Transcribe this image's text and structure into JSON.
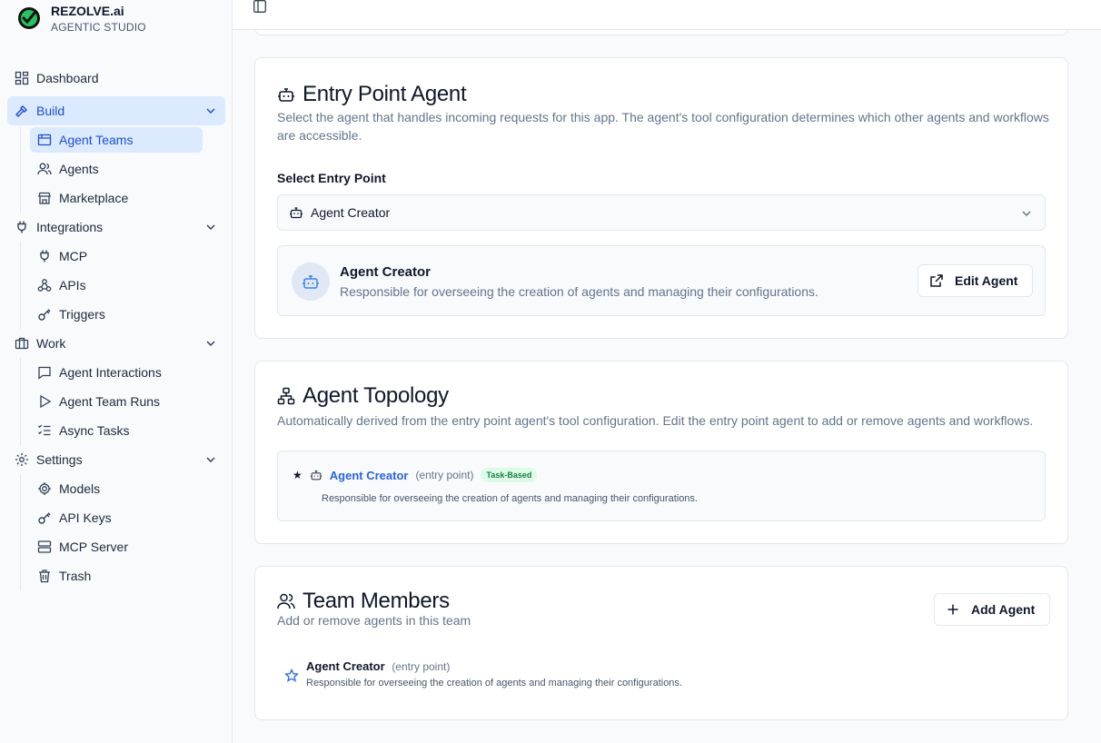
{
  "brand": {
    "name": "REZOLVE.ai",
    "subtitle": "AGENTIC STUDIO"
  },
  "nav": {
    "dashboard": "Dashboard",
    "build": "Build",
    "build_items": [
      "Agent Teams",
      "Agents",
      "Marketplace"
    ],
    "integrations": "Integrations",
    "integrations_items": [
      "MCP",
      "APIs",
      "Triggers"
    ],
    "work": "Work",
    "work_items": [
      "Agent Interactions",
      "Agent Team Runs",
      "Async Tasks"
    ],
    "settings": "Settings",
    "settings_items": [
      "Models",
      "API Keys",
      "MCP Server",
      "Trash"
    ]
  },
  "entry": {
    "title": "Entry Point Agent",
    "description": "Select the agent that handles incoming requests for this app. The agent's tool configuration determines which other agents and workflows are accessible.",
    "select_label": "Select Entry Point",
    "selected": "Agent Creator",
    "agent_name": "Agent Creator",
    "agent_desc": "Responsible for overseeing the creation of agents and managing their configurations.",
    "edit_button": "Edit Agent"
  },
  "topology": {
    "title": "Agent Topology",
    "description": "Automatically derived from the entry point agent's tool configuration. Edit the entry point agent to add or remove agents and workflows.",
    "star": "★",
    "agent_name": "Agent Creator",
    "entry_tag": "(entry point)",
    "badge": "Task-Based",
    "agent_desc": "Responsible for overseeing the creation of agents and managing their configurations."
  },
  "team": {
    "title": "Team Members",
    "description": "Add or remove agents in this team",
    "add_button": "Add Agent",
    "member_name": "Agent Creator",
    "member_tag": "(entry point)",
    "member_desc": "Responsible for overseeing the creation of agents and managing their configurations."
  },
  "colors": {
    "accent": "#2563eb",
    "active_bg": "#dbeafe",
    "badge_bg": "#dcfce7",
    "badge_fg": "#15803d"
  }
}
